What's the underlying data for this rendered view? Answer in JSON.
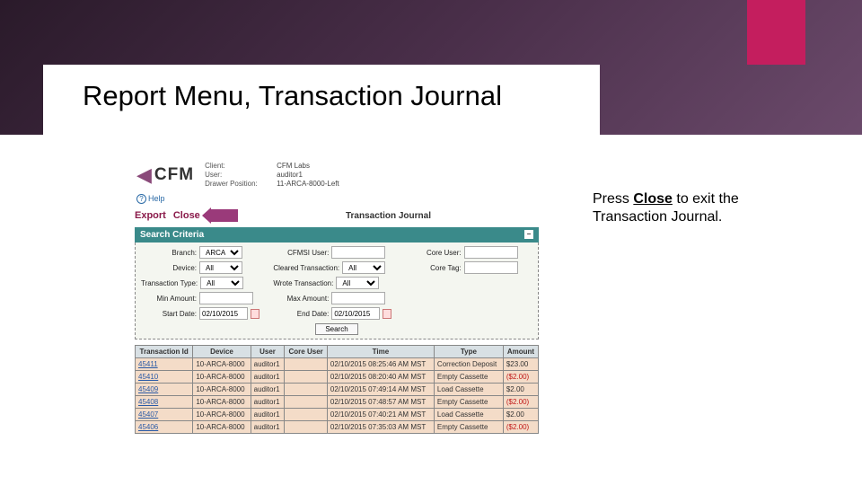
{
  "slide": {
    "title": "Report Menu, Transaction Journal"
  },
  "instruction": {
    "prefix": "Press ",
    "close": "Close",
    "suffix": " to exit the Transaction Journal."
  },
  "logo": {
    "text": "CFM"
  },
  "meta": {
    "client_lbl": "Client:",
    "client_val": "CFM Labs",
    "user_lbl": "User:",
    "user_val": "auditor1",
    "drawer_lbl": "Drawer Position:",
    "drawer_val": "11-ARCA-8000-Left"
  },
  "help_label": "Help",
  "actions": {
    "export": "Export",
    "close": "Close"
  },
  "page_name": "Transaction Journal",
  "criteria": {
    "header": "Search Criteria",
    "branch_lbl": "Branch:",
    "branch_val": "ARCA",
    "cfmsi_user_lbl": "CFMSI User:",
    "core_user_lbl": "Core User:",
    "device_lbl": "Device:",
    "device_val": "All",
    "cleared_lbl": "Cleared Transaction:",
    "cleared_val": "All",
    "core_tag_lbl": "Core Tag:",
    "txn_type_lbl": "Transaction Type:",
    "txn_type_val": "All",
    "wrote_lbl": "Wrote Transaction:",
    "wrote_val": "All",
    "min_amt_lbl": "Min Amount:",
    "max_amt_lbl": "Max Amount:",
    "start_date_lbl": "Start Date:",
    "start_date_val": "02/10/2015",
    "end_date_lbl": "End Date:",
    "end_date_val": "02/10/2015",
    "search_btn": "Search"
  },
  "table": {
    "headers": [
      "Transaction Id",
      "Device",
      "User",
      "Core User",
      "Time",
      "Type",
      "Amount"
    ],
    "rows": [
      {
        "id": "45411",
        "device": "10-ARCA-8000",
        "user": "auditor1",
        "core": "",
        "time": "02/10/2015 08:25:46 AM MST",
        "type": "Correction Deposit",
        "amount": "$23.00",
        "neg": false
      },
      {
        "id": "45410",
        "device": "10-ARCA-8000",
        "user": "auditor1",
        "core": "",
        "time": "02/10/2015 08:20:40 AM MST",
        "type": "Empty Cassette",
        "amount": "($2.00)",
        "neg": true
      },
      {
        "id": "45409",
        "device": "10-ARCA-8000",
        "user": "auditor1",
        "core": "",
        "time": "02/10/2015 07:49:14 AM MST",
        "type": "Load Cassette",
        "amount": "$2.00",
        "neg": false
      },
      {
        "id": "45408",
        "device": "10-ARCA-8000",
        "user": "auditor1",
        "core": "",
        "time": "02/10/2015 07:48:57 AM MST",
        "type": "Empty Cassette",
        "amount": "($2.00)",
        "neg": true
      },
      {
        "id": "45407",
        "device": "10-ARCA-8000",
        "user": "auditor1",
        "core": "",
        "time": "02/10/2015 07:40:21 AM MST",
        "type": "Load Cassette",
        "amount": "$2.00",
        "neg": false
      },
      {
        "id": "45406",
        "device": "10-ARCA-8000",
        "user": "auditor1",
        "core": "",
        "time": "02/10/2015 07:35:03 AM MST",
        "type": "Empty Cassette",
        "amount": "($2.00)",
        "neg": true
      }
    ]
  }
}
